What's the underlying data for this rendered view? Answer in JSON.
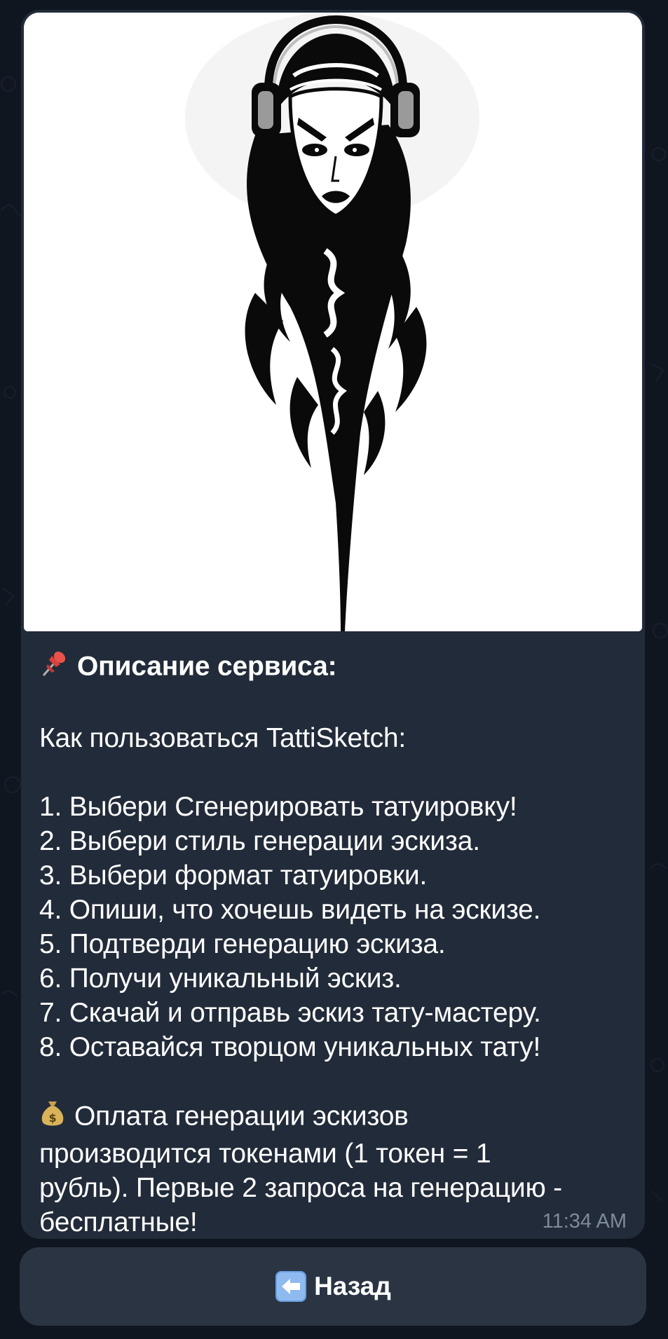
{
  "message": {
    "heading_icon": "pushpin-icon",
    "heading": "Описание сервиса:",
    "subheading": "Как пользоваться TattiSketch:",
    "steps": [
      "1. Выбери Сгенерировать татуировку!",
      "2. Выбери стиль генерации эскиза.",
      "3. Выбери формат татуировки.",
      "4. Опиши, что хочешь видеть на эскизе.",
      "5. Подтверди генерацию эскиза.",
      "6. Получи уникальный эскиз.",
      "7. Скачай и отправь эскиз тату-мастеру.",
      "8. Оставайся творцом уникальных тату!"
    ],
    "payment_icon": "money-bag-icon",
    "payment_lines": [
      "Оплата генерации эскизов",
      "производится токенами (1 токен = 1",
      "рубль). Первые 2 запроса на генерацию -",
      "бесплатные!"
    ],
    "timestamp": "11:34 AM"
  },
  "keyboard": {
    "back_icon": "back-arrow-icon",
    "back_label": "Назад"
  },
  "colors": {
    "background": "#0f1620",
    "bubble": "#222b39",
    "button": "#2a3443",
    "timestamp": "#7f8a98"
  }
}
